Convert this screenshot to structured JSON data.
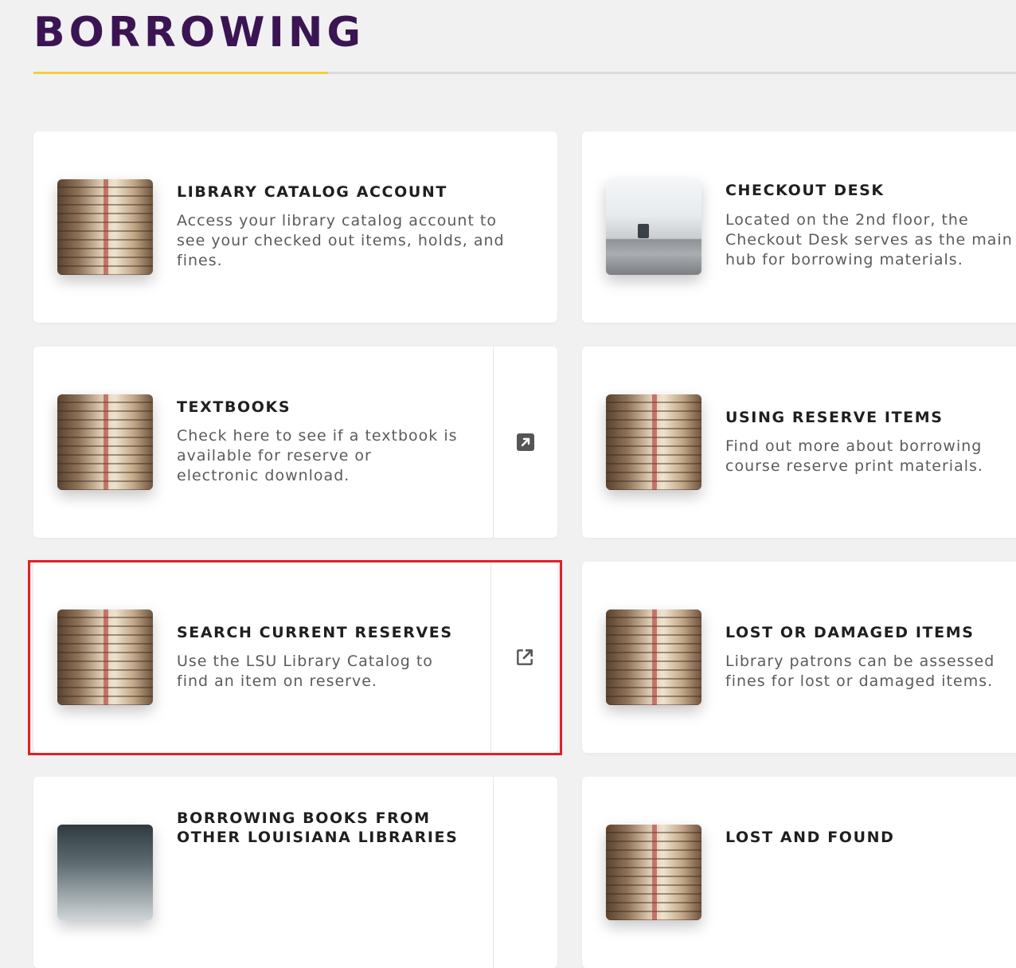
{
  "page": {
    "title": "BORROWING"
  },
  "colors": {
    "title": "#3b1553",
    "accent": "#f2cf3d",
    "highlight": "#e31f26"
  },
  "cards": [
    {
      "title": "LIBRARY CATALOG ACCOUNT",
      "description": "Access your library catalog account to see your checked out items, holds, and fines.",
      "image": "books-image",
      "external": false
    },
    {
      "title": "CHECKOUT DESK",
      "description": "Located on the 2nd floor, the Checkout Desk serves as the main hub for borrowing materials.",
      "image": "checkout-desk-image",
      "external": false
    },
    {
      "title": "TEXTBOOKS",
      "description": "Check here to see if a textbook is available for reserve or electronic download.",
      "image": "books-image",
      "external": true,
      "icon": "external-link-icon"
    },
    {
      "title": "USING RESERVE ITEMS",
      "description": "Find out more about borrowing course reserve print materials.",
      "image": "books-image",
      "external": false
    },
    {
      "title": "SEARCH CURRENT RESERVES",
      "description": "Use the LSU Library Catalog to find an item on reserve.",
      "image": "books-image",
      "external": true,
      "icon": "external-link-icon"
    },
    {
      "title": "LOST OR DAMAGED ITEMS",
      "description": "Library patrons can be assessed fines for lost or damaged items.",
      "image": "books-image",
      "external": false
    },
    {
      "title": "BORROWING BOOKS FROM OTHER LOUISIANA LIBRARIES",
      "description": "",
      "image": "library-shelves-image",
      "external": true
    },
    {
      "title": "LOST AND FOUND",
      "description": "",
      "image": "books-image",
      "external": false
    }
  ]
}
